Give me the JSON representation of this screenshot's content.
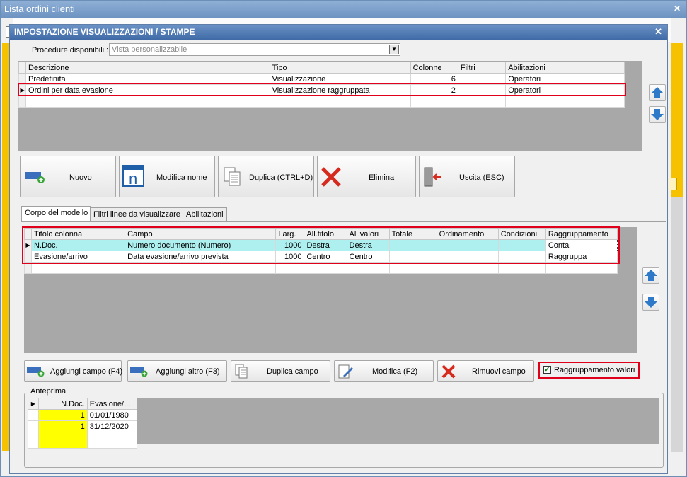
{
  "outer_window": {
    "title": "Lista ordini clienti"
  },
  "dialog": {
    "title": "IMPOSTAZIONE VISUALIZZAZIONI / STAMPE",
    "procedure": {
      "label": "Procedure disponibili :",
      "value": "Vista personalizzabile"
    },
    "views_table": {
      "headers": [
        "Descrizione",
        "Tipo",
        "Colonne",
        "Filtri",
        "Abilitazioni"
      ],
      "rows": [
        [
          "Predefinita",
          "Visualizzazione",
          "6",
          "",
          "Operatori"
        ],
        [
          "Ordini per data evasione",
          "Visualizzazione raggruppata",
          "2",
          "",
          "Operatori"
        ]
      ]
    },
    "actions": {
      "new": "Nuovo",
      "rename": "Modifica nome",
      "duplicate": "Duplica (CTRL+D)",
      "delete": "Elimina",
      "exit": "Uscita (ESC)"
    },
    "tabs": [
      "Corpo del modello",
      "Filtri linee da visualizzare",
      "Abilitazioni"
    ],
    "columns_table": {
      "headers": [
        "Titolo colonna",
        "Campo",
        "Larg.",
        "All.titolo",
        "All.valori",
        "Totale",
        "Ordinamento",
        "Condizioni",
        "Raggruppamento"
      ],
      "rows": [
        [
          "N.Doc.",
          "Numero documento (Numero)",
          "1000",
          "Destra",
          "Destra",
          "",
          "",
          "",
          "Conta"
        ],
        [
          "Evasione/arrivo",
          "Data evasione/arrivo prevista",
          "1000",
          "Centro",
          "Centro",
          "",
          "",
          "",
          "Raggruppa"
        ]
      ]
    },
    "field_actions": {
      "add_field": "Aggiungi campo (F4)",
      "add_other": "Aggiungi altro (F3)",
      "duplicate_field": "Duplica campo",
      "edit": "Modifica (F2)",
      "remove": "Rimuovi campo",
      "grouping_label": "Raggruppamento valori",
      "grouping_checked": true
    },
    "preview": {
      "label": "Anteprima",
      "headers": [
        "N.Doc.",
        "Evasione/..."
      ],
      "rows": [
        [
          "1",
          "01/01/1980"
        ],
        [
          "1",
          "31/12/2020"
        ]
      ]
    }
  },
  "colors": {
    "highlight_row": "#aef0f0",
    "preview_yellow": "#ffff00",
    "red_outline": "#e0001b",
    "outer_accent": "#f6c200"
  }
}
